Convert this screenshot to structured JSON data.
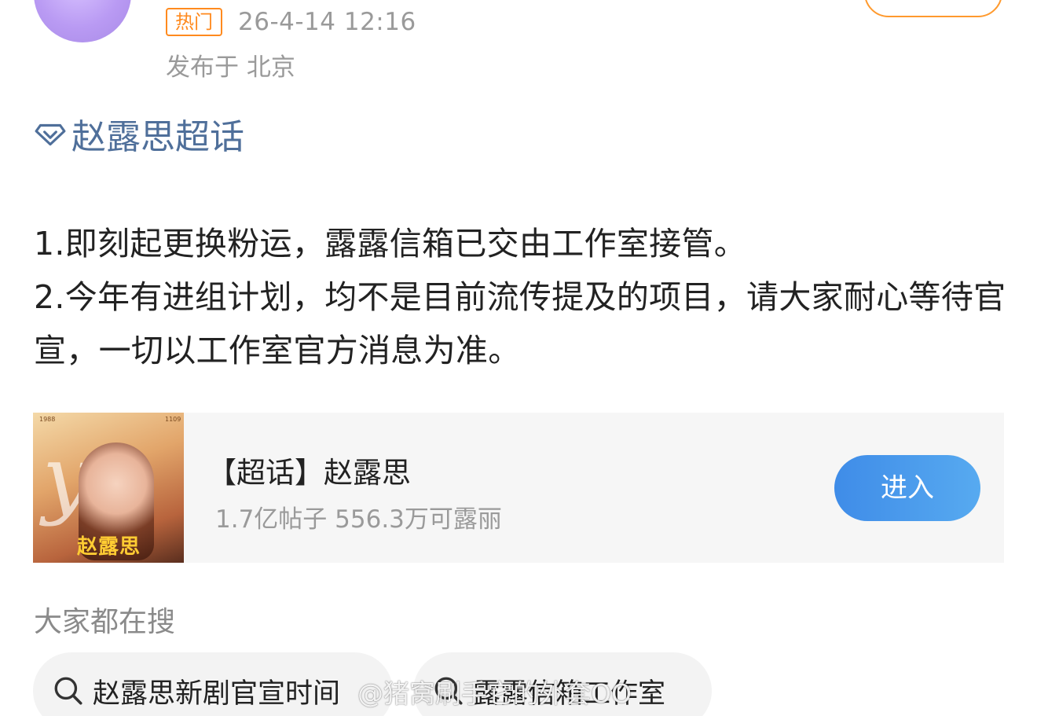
{
  "post": {
    "hot_badge": "热门",
    "timestamp": "26-4-14 12:16",
    "location": "发布于 北京",
    "topic_link": "赵露思超话",
    "paragraphs": [
      "1.即刻起更换粉运，露露信箱已交由工作室接管。",
      "2.今年有进组计划，均不是目前流传提及的项目，请大家耐心等待官宣，一切以工作室官方消息为准。"
    ]
  },
  "super_topic_card": {
    "title": "【超话】赵露思",
    "stats": "1.7亿帖子 556.3万可露丽",
    "enter_label": "进入",
    "cover_name": "赵露思",
    "cover_mark_left": "1988",
    "cover_mark_right": "1109"
  },
  "search": {
    "section_label": "大家都在搜",
    "chips": [
      {
        "label": "赵露思新剧官宣时间"
      },
      {
        "label": "露露信箱工作室"
      }
    ]
  },
  "watermark": "@猪窝刷手它的外套OO",
  "colors": {
    "hot_orange": "#ff8a1e",
    "topic_blue": "#4f6f9a",
    "enter_button_blue": "#3f8ce8",
    "card_background": "#f6f6f6"
  },
  "icons": {
    "topic": "diamond-icon",
    "search": "search-icon"
  }
}
